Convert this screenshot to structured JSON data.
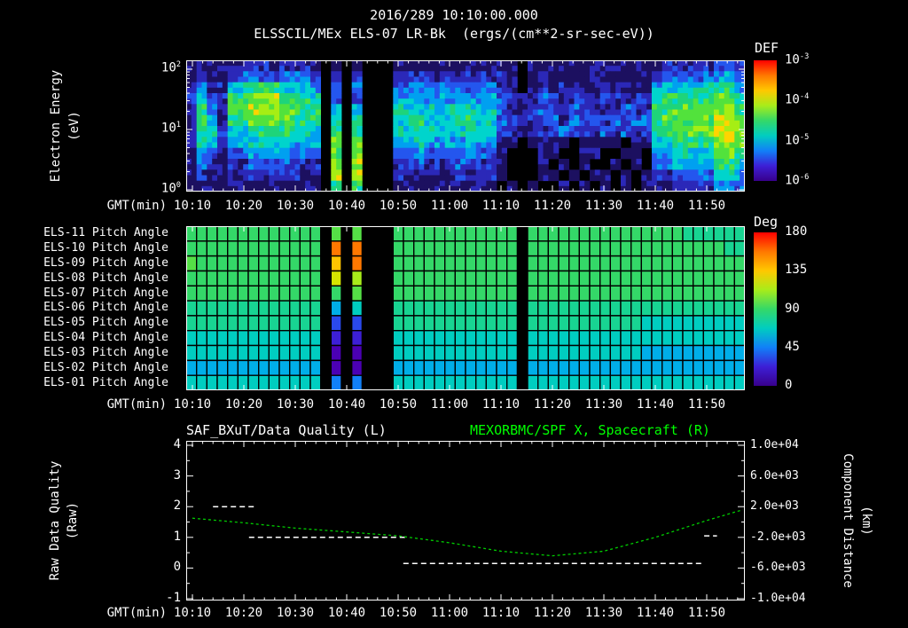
{
  "header": {
    "datetime": "2016/289 10:10:00.000",
    "title": "ELSSCIL/MEx ELS-07 LR-Bk  (ergs/(cm**2-sr-sec-eV))"
  },
  "colors": {
    "background": "#000000",
    "text": "#ffffff",
    "accent_green": "#00ff00"
  },
  "time_axis": {
    "label": "GMT(min)",
    "ticks": [
      "10:10",
      "10:20",
      "10:30",
      "10:40",
      "10:50",
      "11:00",
      "11:10",
      "11:20",
      "11:30",
      "11:40",
      "11:50"
    ]
  },
  "chart_data": [
    {
      "type": "heatmap",
      "name": "electron-energy-spectrogram",
      "title": "ELSSCIL/MEx ELS-07 LR-Bk (ergs/(cm**2-sr-sec-eV))",
      "ylabel_line1": "Electron Energy",
      "ylabel_line2": "(eV)",
      "y_scale": "log",
      "y_ticks": [
        "10^2",
        "10^1",
        "10^0"
      ],
      "y_range_ev": [
        1,
        200
      ],
      "x_label": "GMT(min)",
      "x_start": "10:10",
      "bin_minutes": 2,
      "colorbar": {
        "label": "DEF",
        "units": "ergs/(cm**2-sr-sec-eV)",
        "ticks": [
          "10^-3",
          "10^-4",
          "10^-5",
          "10^-6"
        ],
        "gradient": [
          "#ff0000",
          "#ff7800",
          "#ffc800",
          "#a8ec1a",
          "#34d868",
          "#00cdc0",
          "#1180f8",
          "#3d1fd6",
          "#38008c"
        ]
      },
      "value_note": "rows ordered high energy (top) to 1 eV (bottom); digit 0 = data gap/black, 1-9 = log flux ~1e-6 to ~1e-3",
      "colormap": [
        "#000000",
        "#1c1060",
        "#2b28b8",
        "#2456ee",
        "#00a0f0",
        "#00d4cc",
        "#1ed47a",
        "#52e23c",
        "#a6ee14",
        "#ffd400"
      ],
      "rows": [
        [
          "1111",
          "122212221",
          "0101000",
          "1111111111",
          "11011",
          "1111111111",
          "122222332"
        ],
        [
          "1211",
          "233333332",
          "0202000",
          "2222222222",
          "21012",
          "1111111111",
          "233333443"
        ],
        [
          "2422",
          "456665554",
          "0303000",
          "3333333333",
          "21012",
          "1211121111",
          "455555664"
        ],
        [
          "2522",
          "667786665",
          "0303000",
          "4444444444",
          "32123",
          "2222232222",
          "566666775"
        ],
        [
          "2632",
          "778887766",
          "0404000",
          "5555455555",
          "32123",
          "2232222322",
          "667777886"
        ],
        [
          "2642",
          "667777666",
          "0505000",
          "5565555655",
          "32223",
          "3233323233",
          "677777887"
        ],
        [
          "2652",
          "556666555",
          "0606000",
          "5555555555",
          "22122",
          "2322232322",
          "667777888"
        ],
        [
          "2542",
          "445555444",
          "0707000",
          "4454444544",
          "11011",
          "1101111011",
          "556666887"
        ],
        [
          "1431",
          "334444333",
          "0707000",
          "3343333433",
          "10001",
          "1001100110",
          "445555776"
        ],
        [
          "1321",
          "223333222",
          "0808000",
          "2232223222",
          "10001",
          "0101001010",
          "334444665"
        ],
        [
          "1211",
          "122222211",
          "0808000",
          "2122212122",
          "10001",
          "1010110101",
          "223333554"
        ],
        [
          "1111",
          "111111111",
          "0606000",
          "1111111111",
          "01010",
          "0101010101",
          "112222443"
        ]
      ]
    },
    {
      "type": "heatmap",
      "name": "pitch-angle-panel",
      "row_labels": [
        "ELS-11 Pitch Angle",
        "ELS-10 Pitch Angle",
        "ELS-09 Pitch Angle",
        "ELS-08 Pitch Angle",
        "ELS-07 Pitch Angle",
        "ELS-06 Pitch Angle",
        "ELS-05 Pitch Angle",
        "ELS-04 Pitch Angle",
        "ELS-03 Pitch Angle",
        "ELS-02 Pitch Angle",
        "ELS-01 Pitch Angle"
      ],
      "colorbar": {
        "label": "Deg",
        "ticks": [
          "180",
          "135",
          "90",
          "45",
          "0"
        ],
        "gradient": [
          "#ff0000",
          "#ff7800",
          "#ffc800",
          "#a8ec1a",
          "#34d868",
          "#00cdc0",
          "#1180f8",
          "#3d1fd6",
          "#38008c"
        ]
      },
      "value_note": "hex digit x 12 = pitch angle in degrees; '.' = data gap/black",
      "colormap": [
        "#38008c",
        "#4b00b4",
        "#3d1fd6",
        "#2a49ec",
        "#1180f8",
        "#00aee8",
        "#00cdc0",
        "#18d492",
        "#34d868",
        "#55e046",
        "#7ce62e",
        "#a8ec1a",
        "#d6e400",
        "#ffc400",
        "#ff7800",
        "#ff1e00"
      ],
      "rows": [
        [
          "8888888888888",
          ".9.9...",
          "888888888888.88888888888",
          "8888777777"
        ],
        [
          "8888888888888",
          ".e.e...",
          "888888888888.88888888888",
          "8888888877"
        ],
        [
          "9888888888888",
          ".d.e...",
          "888888888888.88888888888",
          "8888888888"
        ],
        [
          "8888888888888",
          ".c.b...",
          "888888888888.88888888888",
          "8888888888"
        ],
        [
          "8888888888888",
          ".8.9...",
          "888888888888.88888888888",
          "8888888888"
        ],
        [
          "7777777777777",
          ".5.6...",
          "777777777777.77777777777",
          "7777777777"
        ],
        [
          "7777777777777",
          ".3.3...",
          "777777777777.77777777777",
          "6666666666"
        ],
        [
          "6666666666666",
          ".2.2...",
          "666666666666.66666666666",
          "6666666666"
        ],
        [
          "6666666666666",
          ".1.1...",
          "666666666666.66666666666",
          "5555555555"
        ],
        [
          "5555555555555",
          ".1.1...",
          "555555555555.55555555555",
          "5555555555"
        ],
        [
          "6666666666666",
          ".4.4...",
          "666666666666.66666666666",
          "6666666666"
        ]
      ]
    },
    {
      "type": "line",
      "name": "quality-and-spacecraft-distance",
      "title_left": "SAF_BXuT/Data Quality (L)",
      "title_right": "MEXORBMC/SPF X, Spacecraft (R)",
      "ylabel_left_line1": "Raw Data Quality",
      "ylabel_left_line2": "(Raw)",
      "ylabel_right_line1": "Component Distance",
      "ylabel_right_line2": "(km)",
      "left_ticks": [
        "4",
        "3",
        "2",
        "1",
        "0",
        "-1"
      ],
      "left_range": [
        -1,
        4
      ],
      "right_ticks": [
        "1.0e+04",
        "6.0e+03",
        "2.0e+03",
        "-2.0e+03",
        "-6.0e+03",
        "-1.0e+04"
      ],
      "right_range": [
        -10000,
        10000
      ],
      "quality_color": "#ffffff",
      "quality_segments": [
        {
          "value": 2.0,
          "start_min": 4,
          "end_min": 12
        },
        {
          "value": 1.0,
          "start_min": 11,
          "end_min": 41.5
        },
        {
          "value": 0.15,
          "start_min": 41,
          "end_min": 99
        },
        {
          "value": 1.05,
          "start_min": 99.5,
          "end_min": 102
        }
      ],
      "spacecraft_x": {
        "color": "#00cc00",
        "style": "dashed",
        "minutes": [
          0,
          10,
          20,
          30,
          40,
          50,
          60,
          70,
          80,
          90,
          100,
          107
        ],
        "km": [
          500,
          -100,
          -800,
          -1300,
          -1800,
          -2700,
          -3800,
          -4400,
          -3800,
          -2000,
          200,
          1600
        ]
      }
    }
  ]
}
